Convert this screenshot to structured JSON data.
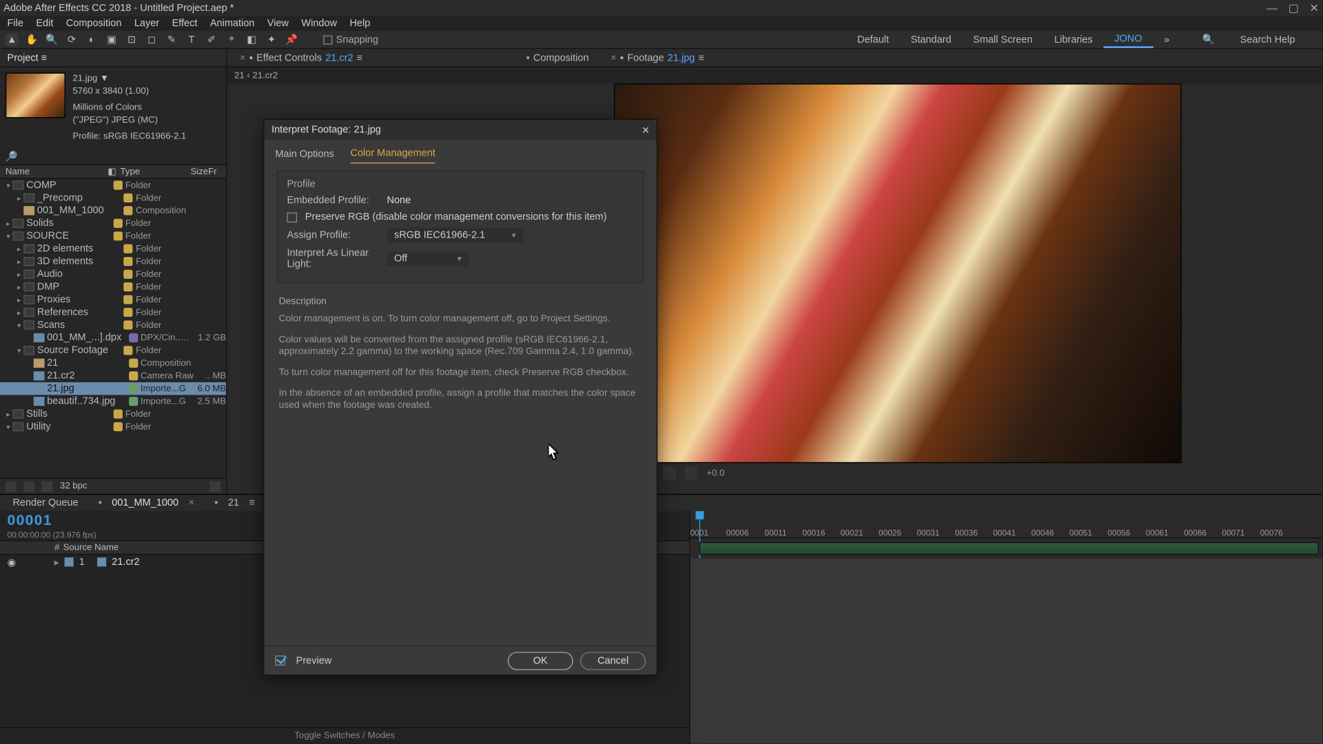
{
  "title_bar": "Adobe After Effects CC 2018 - Untitled Project.aep *",
  "menu": [
    "File",
    "Edit",
    "Composition",
    "Layer",
    "Effect",
    "Animation",
    "View",
    "Window",
    "Help"
  ],
  "snapping_label": "Snapping",
  "workspaces": {
    "items": [
      "Default",
      "Standard",
      "Small Screen",
      "Libraries"
    ],
    "active": "JONO",
    "search_placeholder": "Search Help"
  },
  "project": {
    "tab": "Project",
    "selected_name": "21.jpg ▼",
    "selected_dims": "5760 x 3840 (1.00)",
    "selected_color": "Millions of Colors",
    "selected_format": "(\"JPEG\") JPEG (MC)",
    "selected_profile": "Profile: sRGB IEC61966-2.1",
    "columns": {
      "name": "Name",
      "type": "Type",
      "size": "Size",
      "fr": "Fr"
    },
    "bpc": "32 bpc",
    "tree": [
      {
        "ind": 0,
        "open": true,
        "dot": "y",
        "name": "COMP",
        "type": "Folder"
      },
      {
        "ind": 1,
        "dot": "y",
        "name": "_Precomp",
        "type": "Folder"
      },
      {
        "ind": 1,
        "comp": true,
        "dot": "y",
        "name": "001_MM_1000",
        "type": "Composition"
      },
      {
        "ind": 0,
        "dot": "y",
        "name": "Solids",
        "type": "Folder"
      },
      {
        "ind": 0,
        "open": true,
        "dot": "y",
        "name": "SOURCE",
        "type": "Folder"
      },
      {
        "ind": 1,
        "dot": "y",
        "name": "2D elements",
        "type": "Folder"
      },
      {
        "ind": 1,
        "dot": "y",
        "name": "3D elements",
        "type": "Folder"
      },
      {
        "ind": 1,
        "dot": "y",
        "name": "Audio",
        "type": "Folder"
      },
      {
        "ind": 1,
        "dot": "y",
        "name": "DMP",
        "type": "Folder"
      },
      {
        "ind": 1,
        "dot": "y",
        "name": "Proxies",
        "type": "Folder"
      },
      {
        "ind": 1,
        "dot": "y",
        "name": "References",
        "type": "Folder"
      },
      {
        "ind": 1,
        "open": true,
        "dot": "y",
        "name": "Scans",
        "type": "Folder"
      },
      {
        "ind": 2,
        "file": true,
        "dot": "v",
        "name": "001_MM_...].dpx",
        "type": "DPX/Cin..nce",
        "size": "1.2 GB"
      },
      {
        "ind": 1,
        "open": true,
        "dot": "y",
        "name": "Source Footage",
        "type": "Folder"
      },
      {
        "ind": 2,
        "comp": true,
        "dot": "y",
        "name": "21",
        "type": "Composition"
      },
      {
        "ind": 2,
        "file": true,
        "dot": "y",
        "name": "21.cr2",
        "type": "Camera Raw",
        "size": ".. MB"
      },
      {
        "ind": 2,
        "file": true,
        "dot": "g",
        "name": "21.jpg",
        "type": "Importe...G",
        "size": "6.0 MB",
        "sel": true
      },
      {
        "ind": 2,
        "file": true,
        "dot": "g",
        "name": "beautif..734.jpg",
        "type": "Importe...G",
        "size": "2.5 MB"
      },
      {
        "ind": 0,
        "dot": "y",
        "name": "Stills",
        "type": "Folder"
      },
      {
        "ind": 0,
        "open": true,
        "dot": "y",
        "name": "Utility",
        "type": "Folder"
      }
    ]
  },
  "center": {
    "tab_effect_label": "Effect Controls",
    "tab_effect_item": "21.cr2",
    "tab_comp_label": "Composition",
    "tab_footage_label": "Footage",
    "tab_footage_item": "21.jpg",
    "breadcrumb": "21 ‹ 21.cr2"
  },
  "timeline": {
    "render_queue": "Render Queue",
    "comp_tab": "001_MM_1000",
    "sub_tab": "21",
    "time": "00001",
    "fps": "00:00:00:00 (23.976 fps)",
    "source_name_col": "Source Name",
    "layer": {
      "num": "1",
      "name": "21.cr2"
    },
    "ticks": [
      "0001",
      "00006",
      "00011",
      "00016",
      "00021",
      "00026",
      "00031",
      "00036",
      "00041",
      "00046",
      "00051",
      "00056",
      "00061",
      "00066",
      "00071",
      "00076"
    ],
    "footer": "Toggle Switches / Modes"
  },
  "dialog": {
    "title": "Interpret Footage: 21.jpg",
    "tab_main": "Main Options",
    "tab_color": "Color Management",
    "group_profile": "Profile",
    "embedded_label": "Embedded Profile:",
    "embedded_value": "None",
    "preserve_label": "Preserve RGB (disable color management conversions for this item)",
    "assign_label": "Assign Profile:",
    "assign_value": "sRGB IEC61966-2.1",
    "linear_label": "Interpret As Linear Light:",
    "linear_value": "Off",
    "group_desc": "Description",
    "desc_p1": "Color management is on. To turn color management off, go to Project Settings.",
    "desc_p2": "Color values will be converted from the assigned profile (sRGB IEC61966-2.1, approximately 2.2 gamma) to the working space (Rec.709 Gamma 2.4, 1.0 gamma).",
    "desc_p3": "To turn color management off for this footage item, check Preserve RGB checkbox.",
    "desc_p4": "In the absence of an embedded profile, assign a profile that matches the color space used when the footage was created.",
    "preview_label": "Preview",
    "ok": "OK",
    "cancel": "Cancel"
  }
}
